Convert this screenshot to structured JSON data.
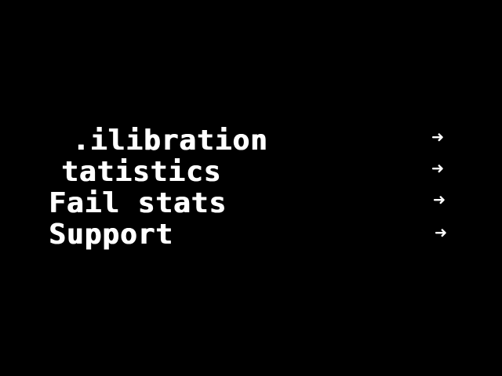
{
  "screen": {
    "background_color": "#000000",
    "text_color": "#ffffff"
  },
  "menu": {
    "items": [
      {
        "label": ".ilibration",
        "arrow": "➜",
        "arrow_icon": "arrow-right-icon"
      },
      {
        "label": "tatistics",
        "arrow": "➜",
        "arrow_icon": "arrow-right-icon"
      },
      {
        "label": "Fail stats",
        "arrow": "➜",
        "arrow_icon": "arrow-right-icon"
      },
      {
        "label": "Support",
        "arrow": "➜",
        "arrow_icon": "arrow-right-icon"
      }
    ]
  }
}
